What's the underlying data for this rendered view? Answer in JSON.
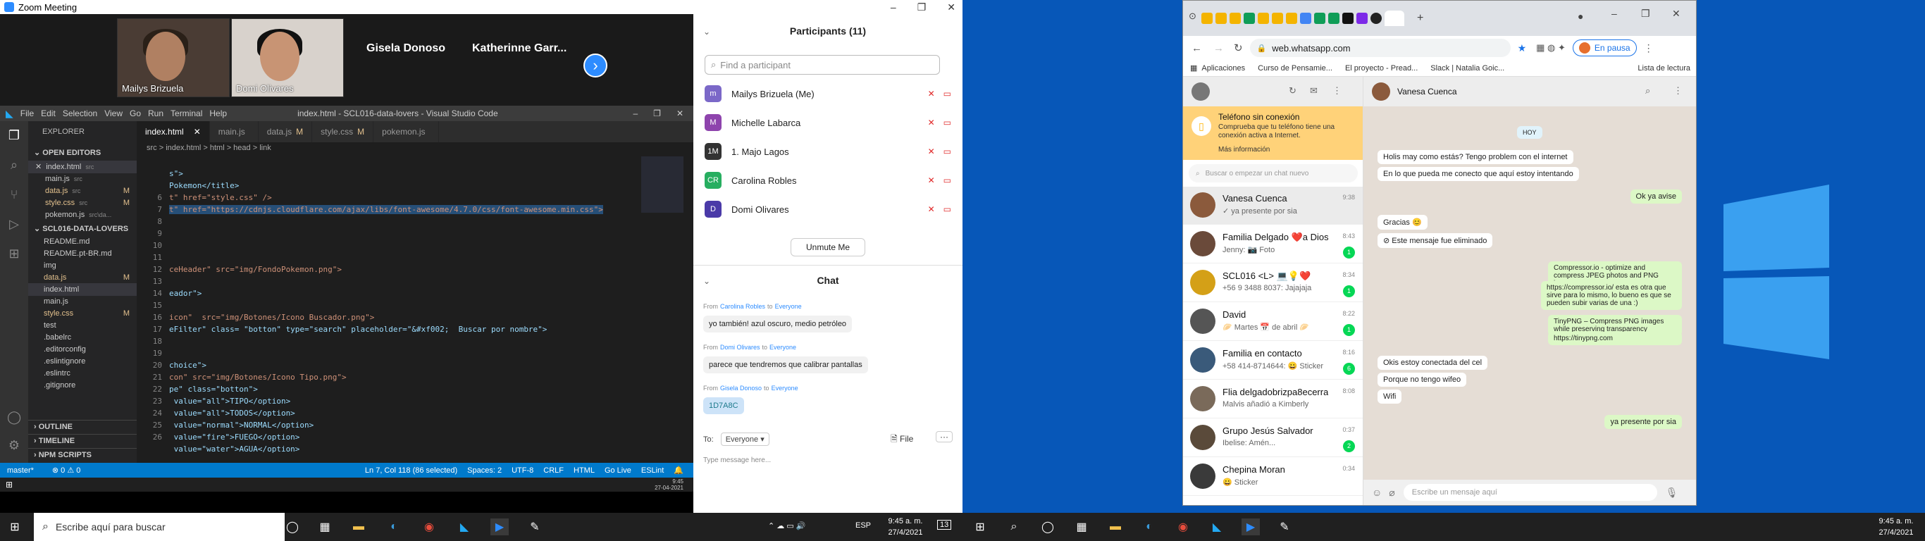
{
  "zoom": {
    "window_title": "Zoom Meeting",
    "participants_thumbs": [
      {
        "name": "Mailys Brizuela"
      },
      {
        "name": "Domi Olivares"
      }
    ],
    "name_tiles": [
      "Gisela Donoso",
      "Katherinne Garr..."
    ],
    "panel": {
      "participants_title": "Participants (11)",
      "find_placeholder": "Find a participant",
      "list": [
        {
          "name": "Mailys Brizuela (Me)",
          "initial": "m",
          "color": "#7b68c8"
        },
        {
          "name": "Michelle Labarca",
          "initial": "M",
          "color": "#8e44ad"
        },
        {
          "name": "1. Majo Lagos",
          "initial": "1M",
          "color": "#333333"
        },
        {
          "name": "Carolina Robles",
          "initial": "CR",
          "color": "#27ae60"
        },
        {
          "name": "Domi Olivares",
          "initial": "D",
          "color": "#4a3aa8"
        }
      ],
      "unmute_label": "Unmute Me",
      "chat_title": "Chat",
      "messages": [
        {
          "from": "Carolina Robles",
          "to": "Everyone",
          "text": "yo también! azul oscuro, medio petróleo"
        },
        {
          "from": "Domi Olivares",
          "to": "Everyone",
          "text": "parece que tendremos que calibrar pantallas"
        },
        {
          "from": "Gisela Donoso",
          "to": "Everyone",
          "text": "1D7A8C"
        }
      ],
      "from_label": "From",
      "to_word": "to",
      "to_label": "To:",
      "to_value": "Everyone",
      "file_label": "File",
      "type_placeholder": "Type message here..."
    }
  },
  "vscode": {
    "title": "index.html - SCL016-data-lovers - Visual Studio Code",
    "menu": [
      "File",
      "Edit",
      "Selection",
      "View",
      "Go",
      "Run",
      "Terminal",
      "Help"
    ],
    "explorer_title": "EXPLORER",
    "sections": {
      "open_editors": "OPEN EDITORS",
      "project": "SCL016-DATA-LOVERS",
      "outline": "OUTLINE",
      "timeline": "TIMELINE",
      "npm": "NPM SCRIPTS"
    },
    "open_editors": [
      {
        "name": "index.html",
        "hint": "src",
        "mod": ""
      },
      {
        "name": "main.js",
        "hint": "src",
        "mod": ""
      },
      {
        "name": "data.js",
        "hint": "src",
        "mod": "M"
      },
      {
        "name": "style.css",
        "hint": "src",
        "mod": "M"
      },
      {
        "name": "pokemon.js",
        "hint": "src\\da...",
        "mod": ""
      }
    ],
    "tree": [
      {
        "name": "README.md",
        "mod": ""
      },
      {
        "name": "README.pt-BR.md",
        "mod": ""
      },
      {
        "name": "img",
        "mod": ""
      },
      {
        "name": "data.js",
        "mod": "M"
      },
      {
        "name": "index.html",
        "mod": ""
      },
      {
        "name": "main.js",
        "mod": ""
      },
      {
        "name": "style.css",
        "mod": "M"
      },
      {
        "name": "test",
        "mod": ""
      },
      {
        "name": ".babelrc",
        "mod": ""
      },
      {
        "name": ".editorconfig",
        "mod": ""
      },
      {
        "name": ".eslintignore",
        "mod": ""
      },
      {
        "name": ".eslintrc",
        "mod": ""
      },
      {
        "name": ".gitignore",
        "mod": ""
      }
    ],
    "tabs": [
      {
        "label": "index.html",
        "mod": ""
      },
      {
        "label": "main.js",
        "mod": ""
      },
      {
        "label": "data.js",
        "mod": "M"
      },
      {
        "label": "style.css",
        "mod": "M"
      },
      {
        "label": "pokemon.js",
        "mod": ""
      }
    ],
    "breadcrumb": "src  >  index.html  >  html  >  head  >  link",
    "code": [
      {
        "n": "",
        "t": ""
      },
      {
        "n": "",
        "t": "s\">"
      },
      {
        "n": "",
        "t": "Pokemon</title>"
      },
      {
        "n": "6",
        "t": "t\" href=\"style.css\" />"
      },
      {
        "n": "7",
        "t": "t\" href=\"https://cdnjs.cloudflare.com/ajax/libs/font-awesome/4.7.0/css/font-awesome.min.css\">"
      },
      {
        "n": "8",
        "t": ""
      },
      {
        "n": "9",
        "t": ""
      },
      {
        "n": "10",
        "t": ""
      },
      {
        "n": "11",
        "t": ""
      },
      {
        "n": "12",
        "t": "ceHeader\" src=\"img/FondoPokemon.png\">"
      },
      {
        "n": "13",
        "t": ""
      },
      {
        "n": "14",
        "t": "eador\">"
      },
      {
        "n": "15",
        "t": ""
      },
      {
        "n": "16",
        "t": "icon\"  src=\"img/Botones/Icono Buscador.png\">"
      },
      {
        "n": "17",
        "t": "eFilter\" class= \"botton\" type=\"search\" placeholder=\"&#xf002;  Buscar por nombre\">"
      },
      {
        "n": "18",
        "t": ""
      },
      {
        "n": "19",
        "t": ""
      },
      {
        "n": "20",
        "t": "choice\">"
      },
      {
        "n": "21",
        "t": "con\" src=\"img/Botones/Icono Tipo.png\">"
      },
      {
        "n": "22",
        "t": "pe\" class=\"botton\">"
      },
      {
        "n": "23",
        "t": " value=\"all\">TIPO</option>"
      },
      {
        "n": "24",
        "t": " value=\"all\">TODOS</option>"
      },
      {
        "n": "25",
        "t": " value=\"normal\">NORMAL</option>"
      },
      {
        "n": "26",
        "t": " value=\"fire\">FUEGO</option>"
      },
      {
        "n": "",
        "t": " value=\"water\">AGUA</option>"
      }
    ],
    "status": {
      "branch": "master*",
      "errors": "⊗ 0 ⚠ 0",
      "pos": "Ln 7, Col 118 (86 selected)",
      "spaces": "Spaces: 2",
      "enc": "UTF-8",
      "eol": "CRLF",
      "lang": "HTML",
      "golive": "Go Live",
      "eslint": "ESLint"
    },
    "tray_time": "9:45",
    "tray_date": "27-04-2021"
  },
  "taskbar": {
    "search_placeholder": "Escribe aquí para buscar",
    "lang": "ESP",
    "time": "9:45 a. m.",
    "date": "27/4/2021",
    "notif": "13"
  },
  "chrome": {
    "url": "web.whatsapp.com",
    "profile_label": "En pausa",
    "bookmarks": [
      "Aplicaciones",
      "Curso de Pensamie...",
      "El proyecto - Pread...",
      "Slack | Natalia Goic...",
      "Lista de lectura"
    ]
  },
  "whatsapp": {
    "banner_title": "Teléfono sin conexión",
    "banner_text": "Comprueba que tu teléfono tiene una conexión activa a Internet.",
    "banner_link": "Más información",
    "search_placeholder": "Buscar o empezar un chat nuevo",
    "chats": [
      {
        "name": "Vanesa Cuenca",
        "last": "✓ ya presente por sia",
        "time": "9:38",
        "badge": "",
        "color": "#8b5a3c"
      },
      {
        "name": "Familia Delgado ❤️a Dios",
        "last": "Jenny: 📷 Foto",
        "time": "8:43",
        "badge": "1",
        "color": "#6a4a3a"
      },
      {
        "name": "SCL016 <L> 💻💡❤️",
        "last": "+56 9 3488 8037: Jajajaja",
        "time": "8:34",
        "badge": "1",
        "color": "#d4a017"
      },
      {
        "name": "David",
        "last": "🥟 Martes 📅 de abril 🥟",
        "time": "8:22",
        "badge": "1",
        "color": "#555555"
      },
      {
        "name": "Familia en contacto",
        "last": "+58 414-8714644: 😀 Sticker",
        "time": "8:16",
        "badge": "6",
        "color": "#3a5a7a"
      },
      {
        "name": "Flia delgadobrizpa8ecerra",
        "last": "Malvis añadió a Kimberly",
        "time": "8:08",
        "badge": "",
        "color": "#7a6a5a"
      },
      {
        "name": "Grupo  Jesús Salvador",
        "last": "Ibelise: Amén...",
        "time": "0:37",
        "badge": "2",
        "color": "#5a4a3a"
      },
      {
        "name": "Chepina Moran",
        "last": "😀 Sticker",
        "time": "0:34",
        "badge": "",
        "color": "#3a3a3a"
      }
    ],
    "contact_name": "Vanesa Cuenca",
    "messages": [
      {
        "dir": "out",
        "text": "HOY"
      },
      {
        "dir": "in",
        "text": "Holis may como estás? Tengo problem con el internet"
      },
      {
        "dir": "in",
        "text": "En lo que pueda me conecto que aquí estoy intentando"
      },
      {
        "dir": "out",
        "text": "Ok ya avise"
      },
      {
        "dir": "in",
        "text": "Gracias 😊"
      },
      {
        "dir": "in",
        "text": "⊘ Este mensaje fue eliminado"
      },
      {
        "dir": "out",
        "text": "Compressor.io - optimize and compress JPEG photos and PNG images"
      },
      {
        "dir": "out",
        "text": "https://compressor.io/ esta es otra que sirve para lo mismo, lo bueno es que se pueden subir varias de una :)"
      },
      {
        "dir": "out",
        "text": "TinyPNG – Compress PNG images while preserving transparency"
      },
      {
        "dir": "out",
        "text": "https://tinypng.com"
      },
      {
        "dir": "in",
        "text": "Okis estoy conectada del cel"
      },
      {
        "dir": "in",
        "text": "Porque no tengo wifeo"
      },
      {
        "dir": "in",
        "text": "Wifi"
      },
      {
        "dir": "out",
        "text": "ya presente por sia"
      }
    ],
    "input_placeholder": "Escribe un mensaje aquí"
  }
}
